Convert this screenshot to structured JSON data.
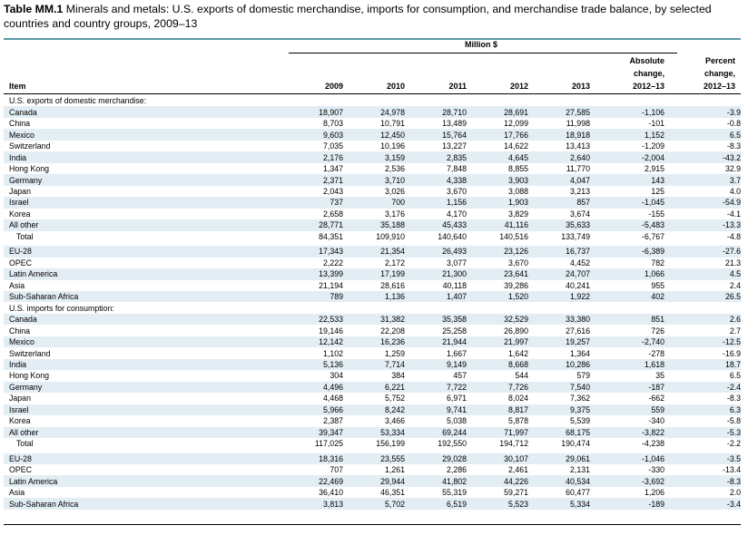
{
  "title": {
    "label": "Table MM.1",
    "text": "Minerals and metals: U.S. exports of domestic merchandise, imports for consumption, and merchandise trade balance, by selected countries and country groups, 2009–13"
  },
  "header": {
    "super_label": "Million $",
    "item_label": "Item",
    "years": [
      "2009",
      "2010",
      "2011",
      "2012",
      "2013"
    ],
    "abs_change": [
      "Absolute",
      "change,",
      "2012–13"
    ],
    "pct_change": [
      "Percent",
      "change,",
      "2012–13"
    ]
  },
  "rows": [
    {
      "type": "section",
      "label": "U.S. exports of domestic merchandise:"
    },
    {
      "type": "row",
      "label": "Canada",
      "values": [
        "18,907",
        "24,978",
        "28,710",
        "28,691",
        "27,585",
        "-1,106",
        "-3.9"
      ]
    },
    {
      "type": "row",
      "label": "China",
      "values": [
        "8,703",
        "10,791",
        "13,489",
        "12,099",
        "11,998",
        "-101",
        "-0.8"
      ]
    },
    {
      "type": "row",
      "label": "Mexico",
      "values": [
        "9,603",
        "12,450",
        "15,764",
        "17,766",
        "18,918",
        "1,152",
        "6.5"
      ]
    },
    {
      "type": "row",
      "label": "Switzerland",
      "values": [
        "7,035",
        "10,196",
        "13,227",
        "14,622",
        "13,413",
        "-1,209",
        "-8.3"
      ]
    },
    {
      "type": "row",
      "label": "India",
      "values": [
        "2,176",
        "3,159",
        "2,835",
        "4,645",
        "2,640",
        "-2,004",
        "-43.2"
      ]
    },
    {
      "type": "row",
      "label": "Hong Kong",
      "values": [
        "1,347",
        "2,536",
        "7,848",
        "8,855",
        "11,770",
        "2,915",
        "32.9"
      ]
    },
    {
      "type": "row",
      "label": "Germany",
      "values": [
        "2,371",
        "3,710",
        "4,338",
        "3,903",
        "4,047",
        "143",
        "3.7"
      ]
    },
    {
      "type": "row",
      "label": "Japan",
      "values": [
        "2,043",
        "3,026",
        "3,670",
        "3,088",
        "3,213",
        "125",
        "4.0"
      ]
    },
    {
      "type": "row",
      "label": "Israel",
      "values": [
        "737",
        "700",
        "1,156",
        "1,903",
        "857",
        "-1,045",
        "-54.9"
      ]
    },
    {
      "type": "row",
      "label": "Korea",
      "values": [
        "2,658",
        "3,176",
        "4,170",
        "3,829",
        "3,674",
        "-155",
        "-4.1"
      ]
    },
    {
      "type": "row",
      "label": "All other",
      "values": [
        "28,771",
        "35,188",
        "45,433",
        "41,116",
        "35,633",
        "-5,483",
        "-13.3"
      ]
    },
    {
      "type": "total",
      "label": "Total",
      "values": [
        "84,351",
        "109,910",
        "140,640",
        "140,516",
        "133,749",
        "-6,767",
        "-4.8"
      ]
    },
    {
      "type": "gap"
    },
    {
      "type": "row",
      "label": "EU-28",
      "values": [
        "17,343",
        "21,354",
        "26,493",
        "23,126",
        "16,737",
        "-6,389",
        "-27.6"
      ]
    },
    {
      "type": "row",
      "label": "OPEC",
      "values": [
        "2,222",
        "2,172",
        "3,077",
        "3,670",
        "4,452",
        "782",
        "21.3"
      ]
    },
    {
      "type": "row",
      "label": "Latin America",
      "values": [
        "13,399",
        "17,199",
        "21,300",
        "23,641",
        "24,707",
        "1,066",
        "4.5"
      ]
    },
    {
      "type": "row",
      "label": "Asia",
      "values": [
        "21,194",
        "28,616",
        "40,118",
        "39,286",
        "40,241",
        "955",
        "2.4"
      ]
    },
    {
      "type": "row",
      "label": "Sub-Saharan Africa",
      "values": [
        "789",
        "1,136",
        "1,407",
        "1,520",
        "1,922",
        "402",
        "26.5"
      ]
    },
    {
      "type": "section",
      "label": "U.S. imports for consumption:"
    },
    {
      "type": "row",
      "label": "Canada",
      "values": [
        "22,533",
        "31,382",
        "35,358",
        "32,529",
        "33,380",
        "851",
        "2.6"
      ]
    },
    {
      "type": "row",
      "label": "China",
      "values": [
        "19,146",
        "22,208",
        "25,258",
        "26,890",
        "27,616",
        "726",
        "2.7"
      ]
    },
    {
      "type": "row",
      "label": "Mexico",
      "values": [
        "12,142",
        "16,236",
        "21,944",
        "21,997",
        "19,257",
        "-2,740",
        "-12.5"
      ]
    },
    {
      "type": "row",
      "label": "Switzerland",
      "values": [
        "1,102",
        "1,259",
        "1,667",
        "1,642",
        "1,364",
        "-278",
        "-16.9"
      ]
    },
    {
      "type": "row",
      "label": "India",
      "values": [
        "5,136",
        "7,714",
        "9,149",
        "8,668",
        "10,286",
        "1,618",
        "18.7"
      ]
    },
    {
      "type": "row",
      "label": "Hong Kong",
      "values": [
        "304",
        "384",
        "457",
        "544",
        "579",
        "35",
        "6.5"
      ]
    },
    {
      "type": "row",
      "label": "Germany",
      "values": [
        "4,496",
        "6,221",
        "7,722",
        "7,726",
        "7,540",
        "-187",
        "-2.4"
      ]
    },
    {
      "type": "row",
      "label": "Japan",
      "values": [
        "4,468",
        "5,752",
        "6,971",
        "8,024",
        "7,362",
        "-662",
        "-8.3"
      ]
    },
    {
      "type": "row",
      "label": "Israel",
      "values": [
        "5,966",
        "8,242",
        "9,741",
        "8,817",
        "9,375",
        "559",
        "6.3"
      ]
    },
    {
      "type": "row",
      "label": "Korea",
      "values": [
        "2,387",
        "3,466",
        "5,038",
        "5,878",
        "5,539",
        "-340",
        "-5.8"
      ]
    },
    {
      "type": "row",
      "label": "All other",
      "values": [
        "39,347",
        "53,334",
        "69,244",
        "71,997",
        "68,175",
        "-3,822",
        "-5.3"
      ]
    },
    {
      "type": "total",
      "label": "Total",
      "values": [
        "117,025",
        "156,199",
        "192,550",
        "194,712",
        "190,474",
        "-4,238",
        "-2.2"
      ]
    },
    {
      "type": "gap"
    },
    {
      "type": "row",
      "label": "EU-28",
      "values": [
        "18,316",
        "23,555",
        "29,028",
        "30,107",
        "29,061",
        "-1,046",
        "-3.5"
      ]
    },
    {
      "type": "row",
      "label": "OPEC",
      "values": [
        "707",
        "1,261",
        "2,286",
        "2,461",
        "2,131",
        "-330",
        "-13.4"
      ]
    },
    {
      "type": "row",
      "label": "Latin America",
      "values": [
        "22,469",
        "29,944",
        "41,802",
        "44,226",
        "40,534",
        "-3,692",
        "-8.3"
      ]
    },
    {
      "type": "row",
      "label": "Asia",
      "values": [
        "36,410",
        "46,351",
        "55,319",
        "59,271",
        "60,477",
        "1,206",
        "2.0"
      ]
    },
    {
      "type": "row",
      "label": "Sub-Saharan Africa",
      "values": [
        "3,813",
        "5,702",
        "6,519",
        "5,523",
        "5,334",
        "-189",
        "-3.4"
      ]
    }
  ],
  "colors": {
    "shade": "#e3edf4",
    "title_rule": "#5a9aa6"
  }
}
